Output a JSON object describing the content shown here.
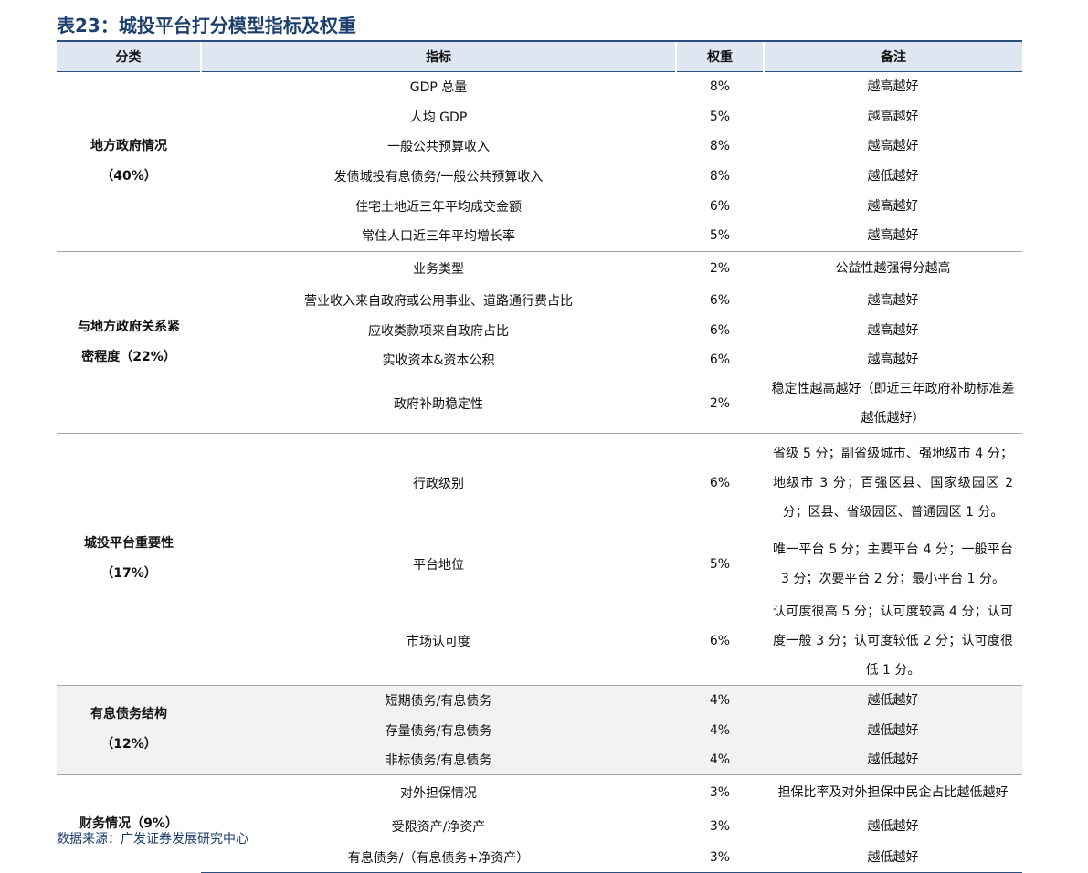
{
  "title": "表23：城投平台打分模型指标及权重",
  "headers": [
    "分类",
    "指标",
    "权重",
    "备注"
  ],
  "groups": [
    {
      "category_line1": "地方政府情况",
      "category_line2": "（40%）",
      "rows": [
        {
          "indicator": "GDP 总量",
          "weight": "8%",
          "remark": "越高越好"
        },
        {
          "indicator": "人均 GDP",
          "weight": "5%",
          "remark": "越高越好"
        },
        {
          "indicator": "一般公共预算收入",
          "weight": "8%",
          "remark": "越高越好"
        },
        {
          "indicator": "发债城投有息债务/一般公共预算收入",
          "weight": "8%",
          "remark": "越低越好"
        },
        {
          "indicator": "住宅土地近三年平均成交金额",
          "weight": "6%",
          "remark": "越高越好"
        },
        {
          "indicator": "常住人口近三年平均增长率",
          "weight": "5%",
          "remark": "越高越好"
        }
      ]
    },
    {
      "category_line1": "与地方政府关系紧",
      "category_line2": "密程度（22%）",
      "rows": [
        {
          "indicator": "业务类型",
          "weight": "2%",
          "remark": "公益性越强得分越高"
        },
        {
          "indicator": "营业收入来自政府或公用事业、道路通行费占比",
          "weight": "6%",
          "remark": "越高越好"
        },
        {
          "indicator": "应收类款项来自政府占比",
          "weight": "6%",
          "remark": "越高越好"
        },
        {
          "indicator": "实收资本&资本公积",
          "weight": "6%",
          "remark": "越高越好"
        },
        {
          "indicator": "政府补助稳定性",
          "weight": "2%",
          "remark": "稳定性越高越好（即近三年政府补助标准差越低越好）"
        }
      ]
    },
    {
      "category_line1": "城投平台重要性",
      "category_line2": "（17%）",
      "rows": [
        {
          "indicator": "行政级别",
          "weight": "6%",
          "remark": "省级 5 分；副省级城市、强地级市 4 分；地级市 3 分；百强区县、国家级园区 2 分；区县、省级园区、普通园区 1 分。"
        },
        {
          "indicator": "平台地位",
          "weight": "5%",
          "remark": "唯一平台 5 分；主要平台 4 分；一般平台 3 分；次要平台 2 分；最小平台 1 分。"
        },
        {
          "indicator": "市场认可度",
          "weight": "6%",
          "remark": "认可度很高 5 分；认可度较高 4 分；认可度一般 3 分；认可度较低 2 分；认可度很低 1 分。"
        }
      ]
    },
    {
      "category_line1": "有息债务结构",
      "category_line2": "（12%）",
      "rows": [
        {
          "indicator": "短期债务/有息债务",
          "weight": "4%",
          "remark": "越低越好"
        },
        {
          "indicator": "存量债务/有息债务",
          "weight": "4%",
          "remark": "越低越好"
        },
        {
          "indicator": "非标债务/有息债务",
          "weight": "4%",
          "remark": "越低越好"
        }
      ]
    },
    {
      "category_line1": "财务情况（9%）",
      "category_line2": "",
      "rows": [
        {
          "indicator": "对外担保情况",
          "weight": "3%",
          "remark": "担保比率及对外担保中民企占比越低越好"
        },
        {
          "indicator": "受限资产/净资产",
          "weight": "3%",
          "remark": "越低越好"
        },
        {
          "indicator": "有息债务/（有息债务+净资产）",
          "weight": "3%",
          "remark": "越低越好"
        }
      ]
    }
  ],
  "source": "数据来源：广发证券发展研究中心"
}
